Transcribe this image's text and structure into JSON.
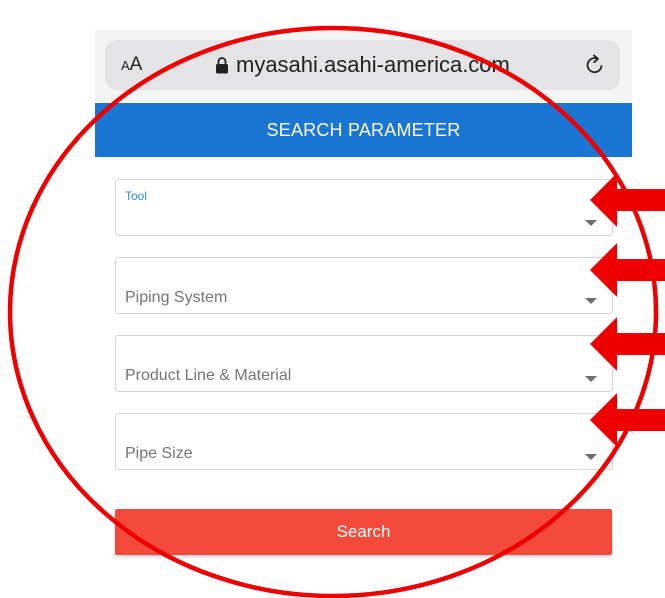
{
  "browser": {
    "aa_label_small": "A",
    "aa_label_large": "A",
    "url": "myasahi.asahi-america.com"
  },
  "header": {
    "title": "SEARCH PARAMETER"
  },
  "form": {
    "fields": [
      {
        "label": "Tool",
        "state": "focused"
      },
      {
        "label": "Piping System",
        "state": "placeholder"
      },
      {
        "label": "Product Line & Material",
        "state": "placeholder"
      },
      {
        "label": "Pipe Size",
        "state": "placeholder"
      }
    ],
    "search_label": "Search"
  },
  "colors": {
    "header_blue": "#1b76d3",
    "button_red": "#f44a3b",
    "annotation_red": "#ee0000",
    "focused_label_blue": "#2f8fd6"
  },
  "annotations": {
    "shapes": [
      "red-circle",
      "red-arrow",
      "red-arrow",
      "red-arrow",
      "red-arrow"
    ]
  }
}
